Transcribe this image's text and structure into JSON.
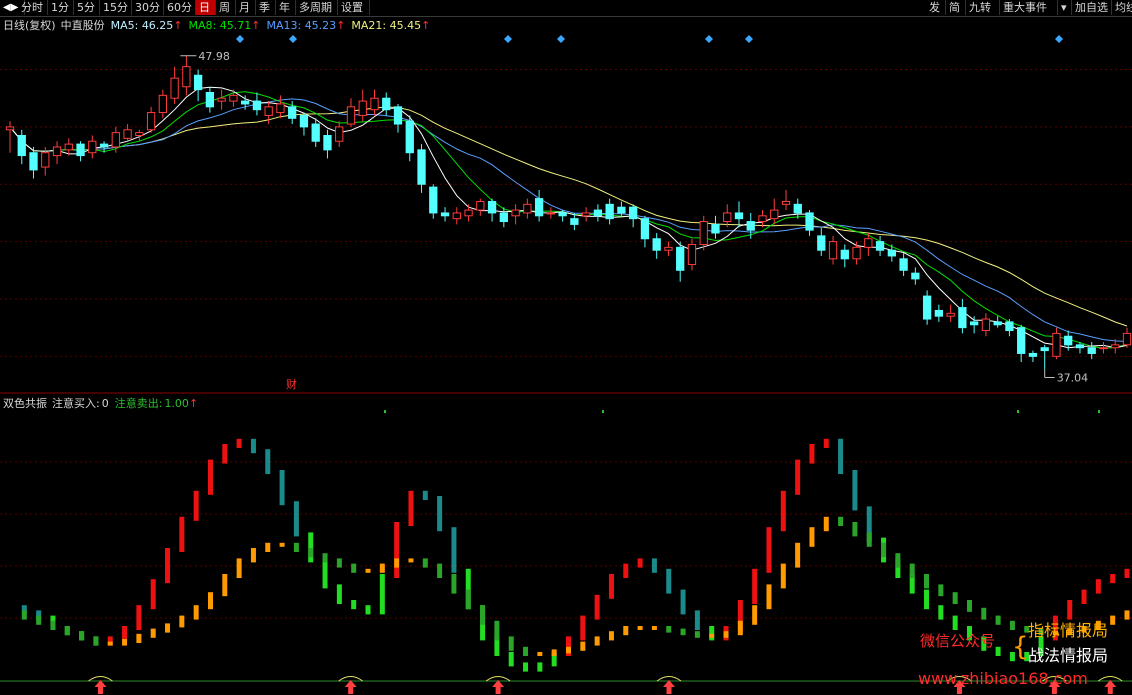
{
  "toolbar": {
    "nav_icon": "◀▶",
    "left_items": [
      "分时",
      "1分",
      "5分",
      "15分",
      "30分",
      "60分",
      "日",
      "周",
      "月",
      "季",
      "年",
      "多周期",
      "设置"
    ],
    "active": "日",
    "right_items": [
      "发",
      "简",
      "九转",
      "重大事件",
      "▾",
      "加自选",
      "均线"
    ]
  },
  "colors": {
    "up": "#ff3c3c",
    "down": "#54ffff",
    "ma5": "#ffffff",
    "ma8": "#00e000",
    "ma13": "#5a9fff",
    "ma21": "#f0f080",
    "grid": "#5a0000",
    "orange": "#ff9a00",
    "green": "#22dd22",
    "teal": "#1a8a8a",
    "red": "#ee1111"
  },
  "main_chart": {
    "title": "日线(复权)",
    "stock": "中直股份",
    "ma": [
      {
        "name": "MA5",
        "value": "46.25",
        "arrow": "↑"
      },
      {
        "name": "MA8",
        "value": "45.71",
        "arrow": "↑"
      },
      {
        "name": "MA13",
        "value": "45.23",
        "arrow": "↑"
      },
      {
        "name": "MA21",
        "value": "45.45",
        "arrow": "↑"
      }
    ],
    "high_label": "47.98",
    "low_label": "37.04",
    "event_label": "财"
  },
  "chart_data": [
    {
      "type": "candlestick",
      "title": "日线(复权)",
      "y_range": [
        36.5,
        48.6
      ],
      "high_price": 47.98,
      "low_price": 37.04,
      "candles": [
        [
          45.4,
          45.5,
          44.6,
          45.7
        ],
        [
          45.2,
          44.5,
          44.2,
          45.4
        ],
        [
          44.6,
          44.0,
          43.7,
          44.8
        ],
        [
          44.1,
          44.6,
          43.8,
          44.8
        ],
        [
          44.5,
          44.8,
          44.2,
          45.0
        ],
        [
          44.7,
          44.9,
          44.5,
          45.1
        ],
        [
          44.9,
          44.5,
          44.3,
          45.0
        ],
        [
          44.6,
          45.0,
          44.4,
          45.2
        ],
        [
          44.9,
          44.8,
          44.6,
          45.0
        ],
        [
          44.8,
          45.3,
          44.6,
          45.5
        ],
        [
          45.1,
          45.4,
          45.0,
          45.6
        ],
        [
          45.2,
          45.3,
          45.0,
          45.4
        ],
        [
          45.4,
          46.0,
          45.3,
          46.2
        ],
        [
          46.0,
          46.6,
          45.8,
          46.8
        ],
        [
          46.5,
          47.2,
          46.3,
          47.6
        ],
        [
          46.9,
          47.6,
          46.6,
          47.98
        ],
        [
          47.3,
          46.8,
          46.4,
          47.5
        ],
        [
          46.7,
          46.2,
          46.0,
          46.9
        ],
        [
          46.4,
          46.5,
          46.1,
          46.8
        ],
        [
          46.4,
          46.6,
          46.2,
          46.8
        ],
        [
          46.4,
          46.3,
          46.1,
          46.6
        ],
        [
          46.4,
          46.1,
          45.9,
          46.7
        ],
        [
          45.9,
          46.2,
          45.6,
          46.4
        ],
        [
          46.0,
          46.3,
          45.8,
          46.6
        ],
        [
          46.2,
          45.8,
          45.6,
          46.4
        ],
        [
          45.9,
          45.5,
          45.2,
          46.0
        ],
        [
          45.6,
          45.0,
          44.8,
          45.8
        ],
        [
          45.2,
          44.7,
          44.4,
          45.4
        ],
        [
          45.0,
          45.5,
          44.8,
          45.7
        ],
        [
          45.6,
          46.2,
          45.5,
          46.5
        ],
        [
          45.9,
          46.4,
          45.7,
          46.8
        ],
        [
          46.1,
          46.5,
          45.9,
          46.8
        ],
        [
          46.5,
          46.1,
          45.9,
          46.7
        ],
        [
          46.2,
          45.6,
          45.3,
          46.3
        ],
        [
          45.7,
          44.6,
          44.3,
          45.9
        ],
        [
          44.7,
          43.5,
          43.2,
          44.9
        ],
        [
          43.4,
          42.5,
          42.3,
          43.5
        ],
        [
          42.5,
          42.4,
          42.2,
          42.7
        ],
        [
          42.3,
          42.5,
          42.1,
          42.7
        ],
        [
          42.4,
          42.6,
          42.2,
          42.8
        ],
        [
          42.6,
          42.9,
          42.4,
          43.0
        ],
        [
          42.9,
          42.5,
          42.2,
          43.0
        ],
        [
          42.5,
          42.2,
          42.0,
          42.7
        ],
        [
          42.4,
          42.6,
          42.1,
          42.8
        ],
        [
          42.5,
          42.8,
          42.3,
          43.0
        ],
        [
          43.0,
          42.4,
          42.2,
          43.3
        ],
        [
          42.5,
          42.5,
          42.3,
          42.7
        ],
        [
          42.5,
          42.4,
          42.2,
          42.6
        ],
        [
          42.3,
          42.1,
          41.9,
          42.5
        ],
        [
          42.4,
          42.5,
          42.2,
          42.7
        ],
        [
          42.6,
          42.4,
          42.2,
          42.8
        ],
        [
          42.8,
          42.3,
          42.1,
          43.0
        ],
        [
          42.7,
          42.5,
          42.4,
          42.9
        ],
        [
          42.7,
          42.3,
          42.0,
          42.8
        ],
        [
          42.3,
          41.6,
          41.3,
          42.4
        ],
        [
          41.6,
          41.2,
          40.9,
          41.8
        ],
        [
          41.2,
          41.3,
          41.0,
          41.5
        ],
        [
          41.3,
          40.5,
          40.1,
          41.5
        ],
        [
          40.7,
          41.4,
          40.5,
          41.6
        ],
        [
          41.4,
          42.2,
          41.2,
          42.4
        ],
        [
          42.1,
          41.8,
          41.6,
          42.4
        ],
        [
          42.2,
          42.5,
          42.0,
          42.8
        ],
        [
          42.5,
          42.3,
          42.0,
          42.9
        ],
        [
          42.2,
          41.9,
          41.6,
          42.5
        ],
        [
          42.2,
          42.4,
          42.0,
          42.6
        ],
        [
          42.3,
          42.6,
          42.1,
          43.0
        ],
        [
          42.8,
          42.9,
          42.6,
          43.3
        ],
        [
          42.8,
          42.5,
          42.3,
          43.0
        ],
        [
          42.5,
          41.9,
          41.7,
          42.6
        ],
        [
          41.7,
          41.2,
          41.0,
          42.0
        ],
        [
          40.9,
          41.5,
          40.7,
          41.7
        ],
        [
          41.2,
          40.9,
          40.6,
          41.4
        ],
        [
          40.9,
          41.3,
          40.7,
          41.5
        ],
        [
          41.3,
          41.6,
          41.0,
          41.8
        ],
        [
          41.5,
          41.2,
          41.0,
          41.7
        ],
        [
          41.2,
          41.0,
          40.8,
          41.4
        ],
        [
          40.9,
          40.5,
          40.3,
          41.1
        ],
        [
          40.4,
          40.2,
          40.0,
          40.6
        ],
        [
          39.6,
          38.8,
          38.6,
          39.8
        ],
        [
          39.1,
          38.9,
          38.7,
          39.3
        ],
        [
          38.9,
          39.0,
          38.7,
          39.3
        ],
        [
          39.2,
          38.5,
          38.3,
          39.5
        ],
        [
          38.7,
          38.6,
          38.3,
          38.9
        ],
        [
          38.4,
          38.8,
          38.2,
          39.0
        ],
        [
          38.7,
          38.6,
          38.5,
          38.9
        ],
        [
          38.7,
          38.4,
          38.2,
          38.8
        ],
        [
          38.5,
          37.6,
          37.3,
          38.6
        ],
        [
          37.6,
          37.5,
          37.3,
          37.7
        ],
        [
          37.8,
          37.7,
          37.04,
          37.9
        ],
        [
          37.5,
          38.3,
          37.4,
          38.5
        ],
        [
          38.2,
          37.9,
          37.7,
          38.4
        ],
        [
          37.9,
          37.8,
          37.6,
          38.0
        ],
        [
          37.8,
          37.6,
          37.4,
          38.0
        ],
        [
          37.8,
          37.8,
          37.6,
          38.0
        ],
        [
          37.8,
          37.9,
          37.6,
          38.1
        ],
        [
          37.9,
          38.3,
          37.8,
          38.5
        ]
      ]
    },
    {
      "type": "bar",
      "title": "双色共振",
      "label_buy": "注意买入:",
      "value_buy": "0",
      "label_sell": "注意卖出:",
      "value_sell": "1.00",
      "sell_arrow": "↑",
      "y_range": [
        0,
        100
      ],
      "series": [
        {
          "values": [
            28,
            26,
            24,
            20,
            18,
            16,
            14,
            16,
            20,
            28,
            38,
            50,
            62,
            72,
            84,
            90,
            92,
            88,
            80,
            68,
            56,
            46,
            36,
            30,
            28,
            26,
            40,
            60,
            72,
            70,
            58,
            42,
            28,
            16,
            10,
            6,
            4,
            6,
            10,
            16,
            24,
            32,
            40,
            44,
            46,
            42,
            34,
            26,
            20,
            16,
            20,
            30,
            42,
            58,
            72,
            84,
            90,
            92,
            80,
            66,
            54,
            46,
            40,
            34,
            28,
            24,
            20,
            16,
            12,
            10,
            8,
            10,
            16,
            24,
            30,
            34,
            38,
            40,
            42
          ]
        },
        {
          "values": [
            26,
            24,
            22,
            20,
            18,
            16,
            14,
            14,
            15,
            17,
            19,
            21,
            24,
            28,
            33,
            40,
            46,
            50,
            52,
            52,
            50,
            48,
            46,
            44,
            42,
            42,
            44,
            46,
            46,
            44,
            40,
            34,
            28,
            22,
            16,
            12,
            10,
            10,
            11,
            12,
            14,
            16,
            18,
            20,
            20,
            20,
            19,
            18,
            17,
            17,
            18,
            22,
            28,
            36,
            44,
            52,
            58,
            62,
            60,
            56,
            52,
            48,
            44,
            40,
            36,
            33,
            30,
            27,
            24,
            22,
            20,
            19,
            18,
            18,
            19,
            20,
            22,
            24,
            26
          ]
        }
      ],
      "buy_markers": [
        0.081,
        0.305,
        0.437,
        0.59,
        0.85,
        0.935,
        0.985
      ]
    }
  ],
  "watermark": {
    "label": "微信公众号",
    "line1": "指标情报局",
    "line2": "战法情报局",
    "url": "www.zhibiao168.com"
  }
}
